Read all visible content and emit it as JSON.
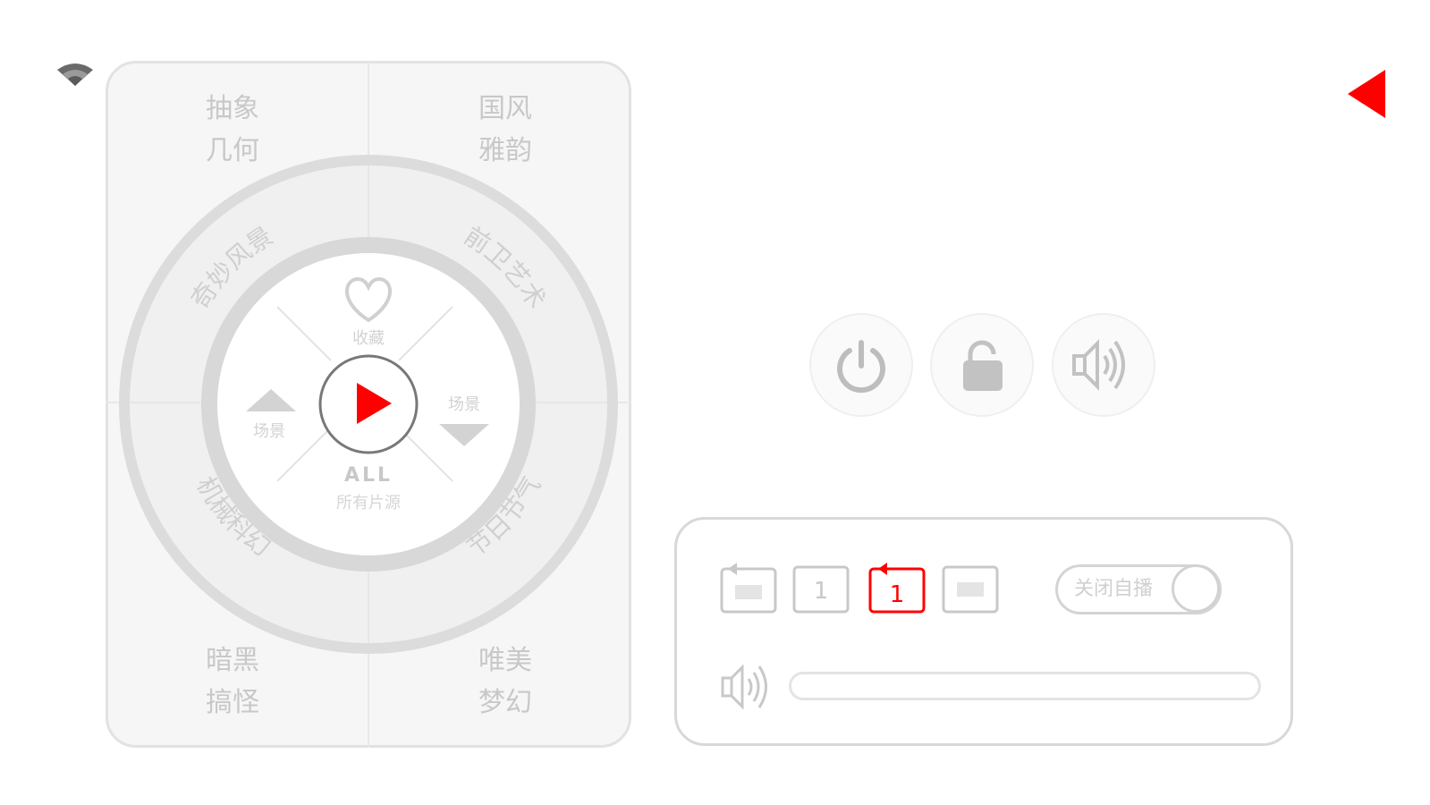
{
  "colors": {
    "accent": "#ff0000",
    "panel_bg": "#f6f6f6",
    "ring": "#dcdcdc",
    "text_muted": "#c8c8c8"
  },
  "status": {
    "wifi_icon": "wifi-icon"
  },
  "navigation": {
    "back_icon": "back-arrow-icon"
  },
  "dial": {
    "corners": {
      "top_left": [
        "抽象",
        "几何"
      ],
      "top_right": [
        "国风",
        "雅韵"
      ],
      "bottom_left": [
        "暗黑",
        "搞怪"
      ],
      "bottom_right": [
        "唯美",
        "梦幻"
      ]
    },
    "ring": {
      "top_left": "奇妙风景",
      "top_right": "前卫艺术",
      "bottom_left": "机械科幻",
      "bottom_right": "节日节气"
    },
    "inner": {
      "favorite_label": "收藏",
      "prev_label": "场景",
      "next_label": "场景",
      "all_label": "ALL",
      "all_sub": "所有片源"
    },
    "play_icon": "play-icon"
  },
  "quick_actions": [
    {
      "name": "power",
      "icon": "power-icon"
    },
    {
      "name": "lock",
      "icon": "lock-icon"
    },
    {
      "name": "sound",
      "icon": "speaker-icon"
    }
  ],
  "playback_modes": [
    {
      "name": "loop-all",
      "label": "",
      "active": false
    },
    {
      "name": "single",
      "label": "1",
      "active": false
    },
    {
      "name": "repeat-one",
      "label": "1",
      "active": true
    },
    {
      "name": "list",
      "label": "",
      "active": false
    }
  ],
  "autoplay": {
    "label": "关闭自播",
    "enabled": false
  },
  "volume": {
    "icon": "speaker-icon",
    "level": 0
  }
}
